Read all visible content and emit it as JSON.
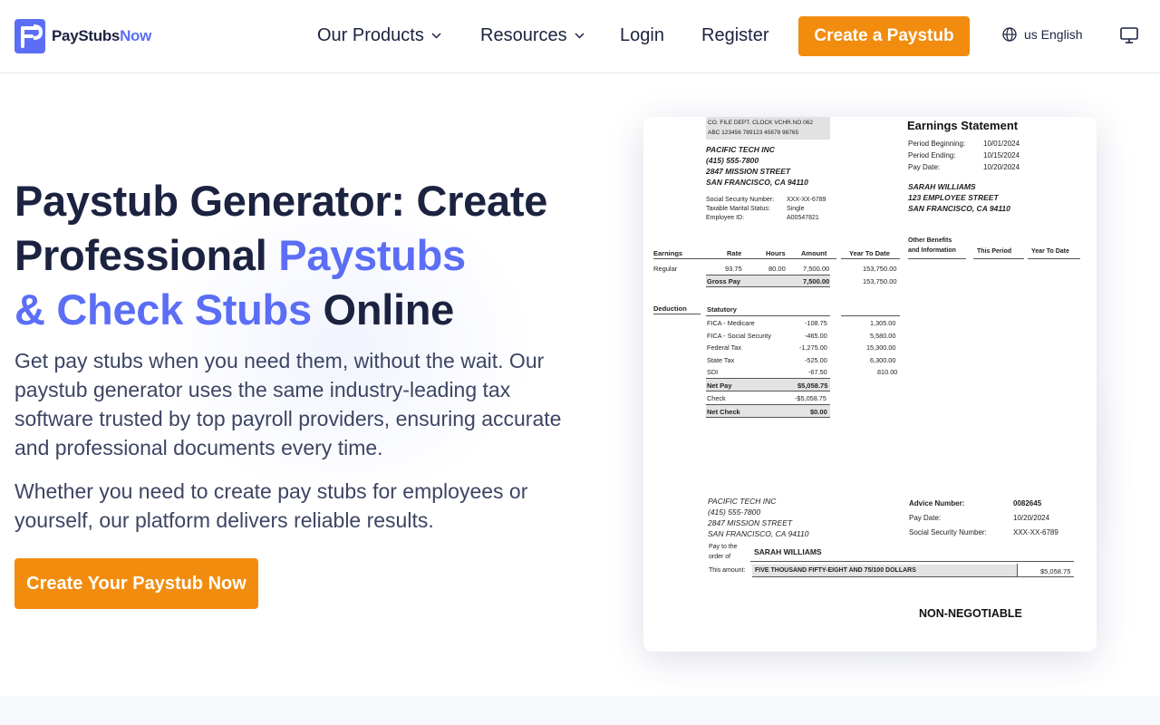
{
  "header": {
    "logo_text_main": "PayStubs",
    "logo_text_accent": "Now",
    "nav": [
      {
        "label": "Our Products"
      },
      {
        "label": "Resources"
      },
      {
        "label": "Login"
      },
      {
        "label": "Register"
      }
    ],
    "cta": "Create a Paystub",
    "language": "us English"
  },
  "hero": {
    "title_line1": "Paystub Generator: Create",
    "title_line2_a": "Professional ",
    "title_line2_b": "Paystubs",
    "title_line3_a": "& Check Stubs",
    "title_line3_b": " Online",
    "paragraph1": "Get pay stubs when you need them, without the wait. Our paystub generator uses the same industry-leading tax software trusted by top payroll providers, ensuring accurate and professional documents every time.",
    "paragraph2": "Whether you need to create pay stubs for employees or yourself, our platform delivers reliable results.",
    "cta": "Create Your Paystub Now"
  },
  "paystub": {
    "codes_header": "CO.   FILE   DEPT.  CLOCK VCHR.NO 062",
    "codes_values": "ABC 123456 789123  45678     98765",
    "company": {
      "name": "PACIFIC TECH INC",
      "phone": "(415) 555-7800",
      "street": "2847 MISSION STREET",
      "city": "SAN FRANCISCO, CA 94110"
    },
    "info_labels": [
      "Social Security Number:",
      "Taxable Marital Status:",
      "Employee ID:"
    ],
    "info_values": [
      "XXX-XX-6789",
      "Single",
      "A00547821"
    ],
    "title": "Earnings Statement",
    "period_labels": [
      "Period Beginning:",
      "Period Ending:",
      "Pay Date:"
    ],
    "period_values": [
      "10/01/2024",
      "10/15/2024",
      "10/20/2024"
    ],
    "employee": {
      "name": "SARAH WILLIAMS",
      "street": "123 EMPLOYEE STREET",
      "city": "SAN FRANCISCO, CA 94110"
    },
    "earnings_headers": {
      "earnings": "Earnings",
      "rate": "Rate",
      "hours": "Hours",
      "amount": "Amount",
      "ytd": "Year To Date",
      "other1": "Other Benefits",
      "other2": "and Information",
      "this_period": "This Period",
      "ytd2": "Year To Date"
    },
    "regular": {
      "label": "Regular",
      "rate": "93.75",
      "hours": "80.00",
      "amount": "7,500.00",
      "ytd": "153,750.00"
    },
    "gross": {
      "label": "Gross Pay",
      "amount": "7,500.00",
      "ytd": "153,750.00"
    },
    "deduction_label": "Deduction",
    "statutory_label": "Statutory",
    "deductions": [
      {
        "label": "FICA - Medicare",
        "amount": "-108.75",
        "ytd": "1,305.00"
      },
      {
        "label": "FICA - Social Security",
        "amount": "-465.00",
        "ytd": "5,580.00"
      },
      {
        "label": "Federal Tax",
        "amount": "-1,275.00",
        "ytd": "15,300.00"
      },
      {
        "label": "State Tax",
        "amount": "-525.00",
        "ytd": "6,300.00"
      },
      {
        "label": "SDI",
        "amount": "-67.50",
        "ytd": "810.00"
      }
    ],
    "net_pay": {
      "label": "Net Pay",
      "amount": "$5,058.75"
    },
    "check": {
      "label": "Check",
      "amount": "-$5,058.75"
    },
    "net_check": {
      "label": "Net Check",
      "amount": "$0.00"
    },
    "advice_labels": [
      "Advice Number:",
      "Pay Date:",
      "Social Security Number:"
    ],
    "advice_values": [
      "0082645",
      "10/20/2024",
      "XXX-XX-6789"
    ],
    "pay_to_label_1": "Pay to the",
    "pay_to_label_2": "order of",
    "pay_to_name": "SARAH WILLIAMS",
    "amount_label": "This amount:",
    "amount_words": "FIVE THOUSAND FIFTY-EIGHT AND 75/100 DOLLARS",
    "amount_value": "$5,058.75",
    "non_negotiable": "NON-NEGOTIABLE"
  },
  "colors": {
    "brand_orange": "#f28c0f",
    "accent_blue": "#5b6ef5",
    "text_dark": "#1c2340"
  },
  "icons": [
    "logo-icon",
    "chevron-down-icon",
    "globe-icon",
    "monitor-icon"
  ]
}
